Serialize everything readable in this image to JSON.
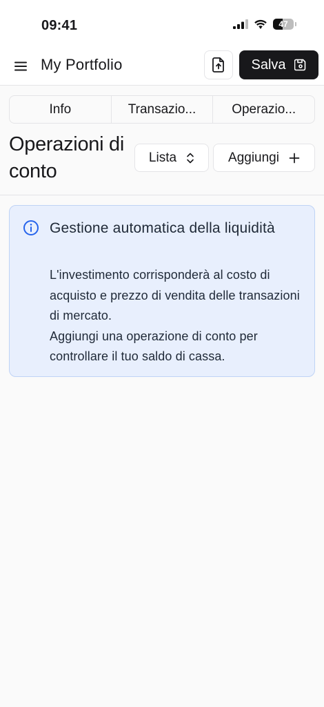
{
  "status_bar": {
    "time": "09:41",
    "battery_level": "47",
    "icons": [
      "signal-icon",
      "wifi-icon",
      "battery-icon"
    ]
  },
  "header": {
    "title": "My Portfolio",
    "menu_icon": "hamburger-menu-icon",
    "export_icon": "file-upload-icon",
    "save_label": "Salva",
    "save_icon": "floppy-disk-icon"
  },
  "tabs": [
    {
      "label": "Info"
    },
    {
      "label": "Transazio..."
    },
    {
      "label": "Operazio..."
    }
  ],
  "section": {
    "title": "Operazioni di conto",
    "view_select_label": "Lista",
    "view_select_icon": "chevron-up-down-icon",
    "add_label": "Aggiungi",
    "add_icon": "plus-icon"
  },
  "alert": {
    "icon": "info-icon",
    "title": "Gestione automatica della liquidità",
    "line1": "L'investimento corrisponderà al costo di acquisto e prezzo di vendita delle transazioni di mercato.",
    "line2": "Aggiungi una operazione di conto per controllare il tuo saldo di cassa."
  },
  "colors": {
    "primary": "#18181b",
    "border": "#e4e4e7",
    "background": "#fafafa",
    "alert_background": "#e8effd",
    "alert_border": "#bfd3f5",
    "info_accent": "#2563eb"
  }
}
